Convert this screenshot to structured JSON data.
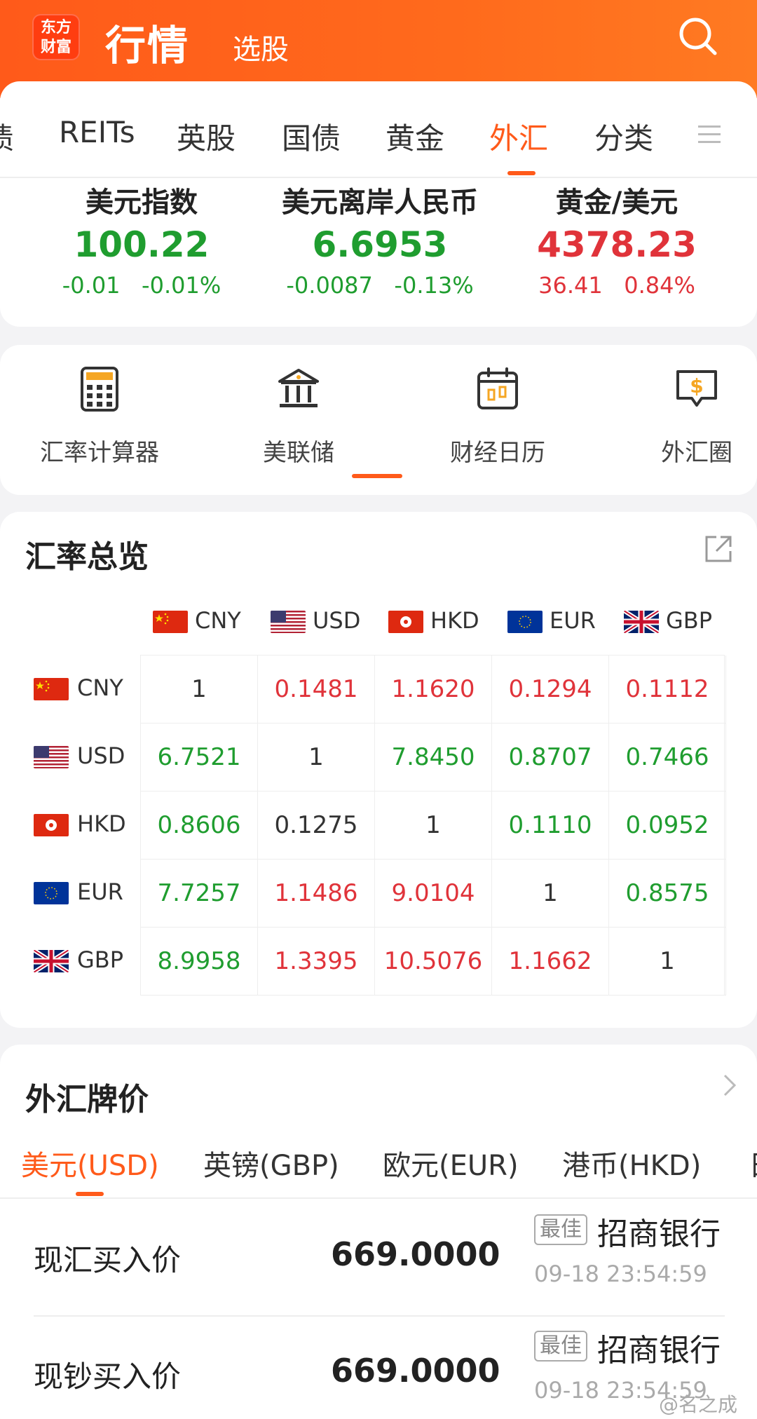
{
  "header": {
    "logo_line1": "东方",
    "logo_line2": "财富",
    "title": "行情",
    "subtitle": "选股"
  },
  "tabs": [
    {
      "label": "债"
    },
    {
      "label": "REITs"
    },
    {
      "label": "英股"
    },
    {
      "label": "国债"
    },
    {
      "label": "黄金"
    },
    {
      "label": "外汇"
    },
    {
      "label": "分类"
    }
  ],
  "active_tab": "外汇",
  "indices": [
    {
      "name": "美元指数",
      "value": "100.22",
      "change": "-0.01",
      "change_pct": "-0.01%",
      "direction": "down"
    },
    {
      "name": "美元离岸人民币",
      "value": "6.6953",
      "change": "-0.0087",
      "change_pct": "-0.13%",
      "direction": "down"
    },
    {
      "name": "黄金/美元",
      "value": "4378.23",
      "change": "36.41",
      "change_pct": "0.84%",
      "direction": "up"
    }
  ],
  "tools": [
    {
      "label": "汇率计算器",
      "icon": "calculator-icon"
    },
    {
      "label": "美联储",
      "icon": "bank-icon"
    },
    {
      "label": "财经日历",
      "icon": "calendar-icon"
    },
    {
      "label": "外汇圈",
      "icon": "dollar-chat-icon"
    }
  ],
  "rates": {
    "title": "汇率总览",
    "currencies": [
      "CNY",
      "USD",
      "HKD",
      "EUR",
      "GBP"
    ],
    "matrix": [
      [
        "1",
        "0.1481",
        "1.1620",
        "0.1294",
        "0.1112"
      ],
      [
        "6.7521",
        "1",
        "7.8450",
        "0.8707",
        "0.7466"
      ],
      [
        "0.8606",
        "0.1275",
        "1",
        "0.1110",
        "0.0952"
      ],
      [
        "7.7257",
        "1.1486",
        "9.0104",
        "1",
        "0.8575"
      ],
      [
        "8.9958",
        "1.3395",
        "10.5076",
        "1.1662",
        "1"
      ]
    ],
    "colors": [
      [
        "neutral",
        "red",
        "red",
        "red",
        "red"
      ],
      [
        "green",
        "neutral",
        "green",
        "green",
        "green"
      ],
      [
        "green",
        "neutral",
        "neutral",
        "green",
        "green"
      ],
      [
        "green",
        "red",
        "red",
        "neutral",
        "green"
      ],
      [
        "green",
        "red",
        "red",
        "red",
        "neutral"
      ]
    ]
  },
  "quotes": {
    "title": "外汇牌价",
    "currency_tabs": [
      "美元(USD)",
      "英镑(GBP)",
      "欧元(EUR)",
      "港币(HKD)",
      "日"
    ],
    "active_currency": "美元(USD)",
    "rows": [
      {
        "label": "现汇买入价",
        "value": "669.0000",
        "badge": "最佳",
        "bank": "招商银行",
        "time": "09-18 23:54:59"
      },
      {
        "label": "现钞买入价",
        "value": "669.0000",
        "badge": "最佳",
        "bank": "招商银行",
        "time": "09-18 23:54:59"
      }
    ]
  },
  "watermark": "@名之成",
  "colors": {
    "accent": "#ff5a1a",
    "up": "#e0333a",
    "down": "#1f9d2f"
  }
}
